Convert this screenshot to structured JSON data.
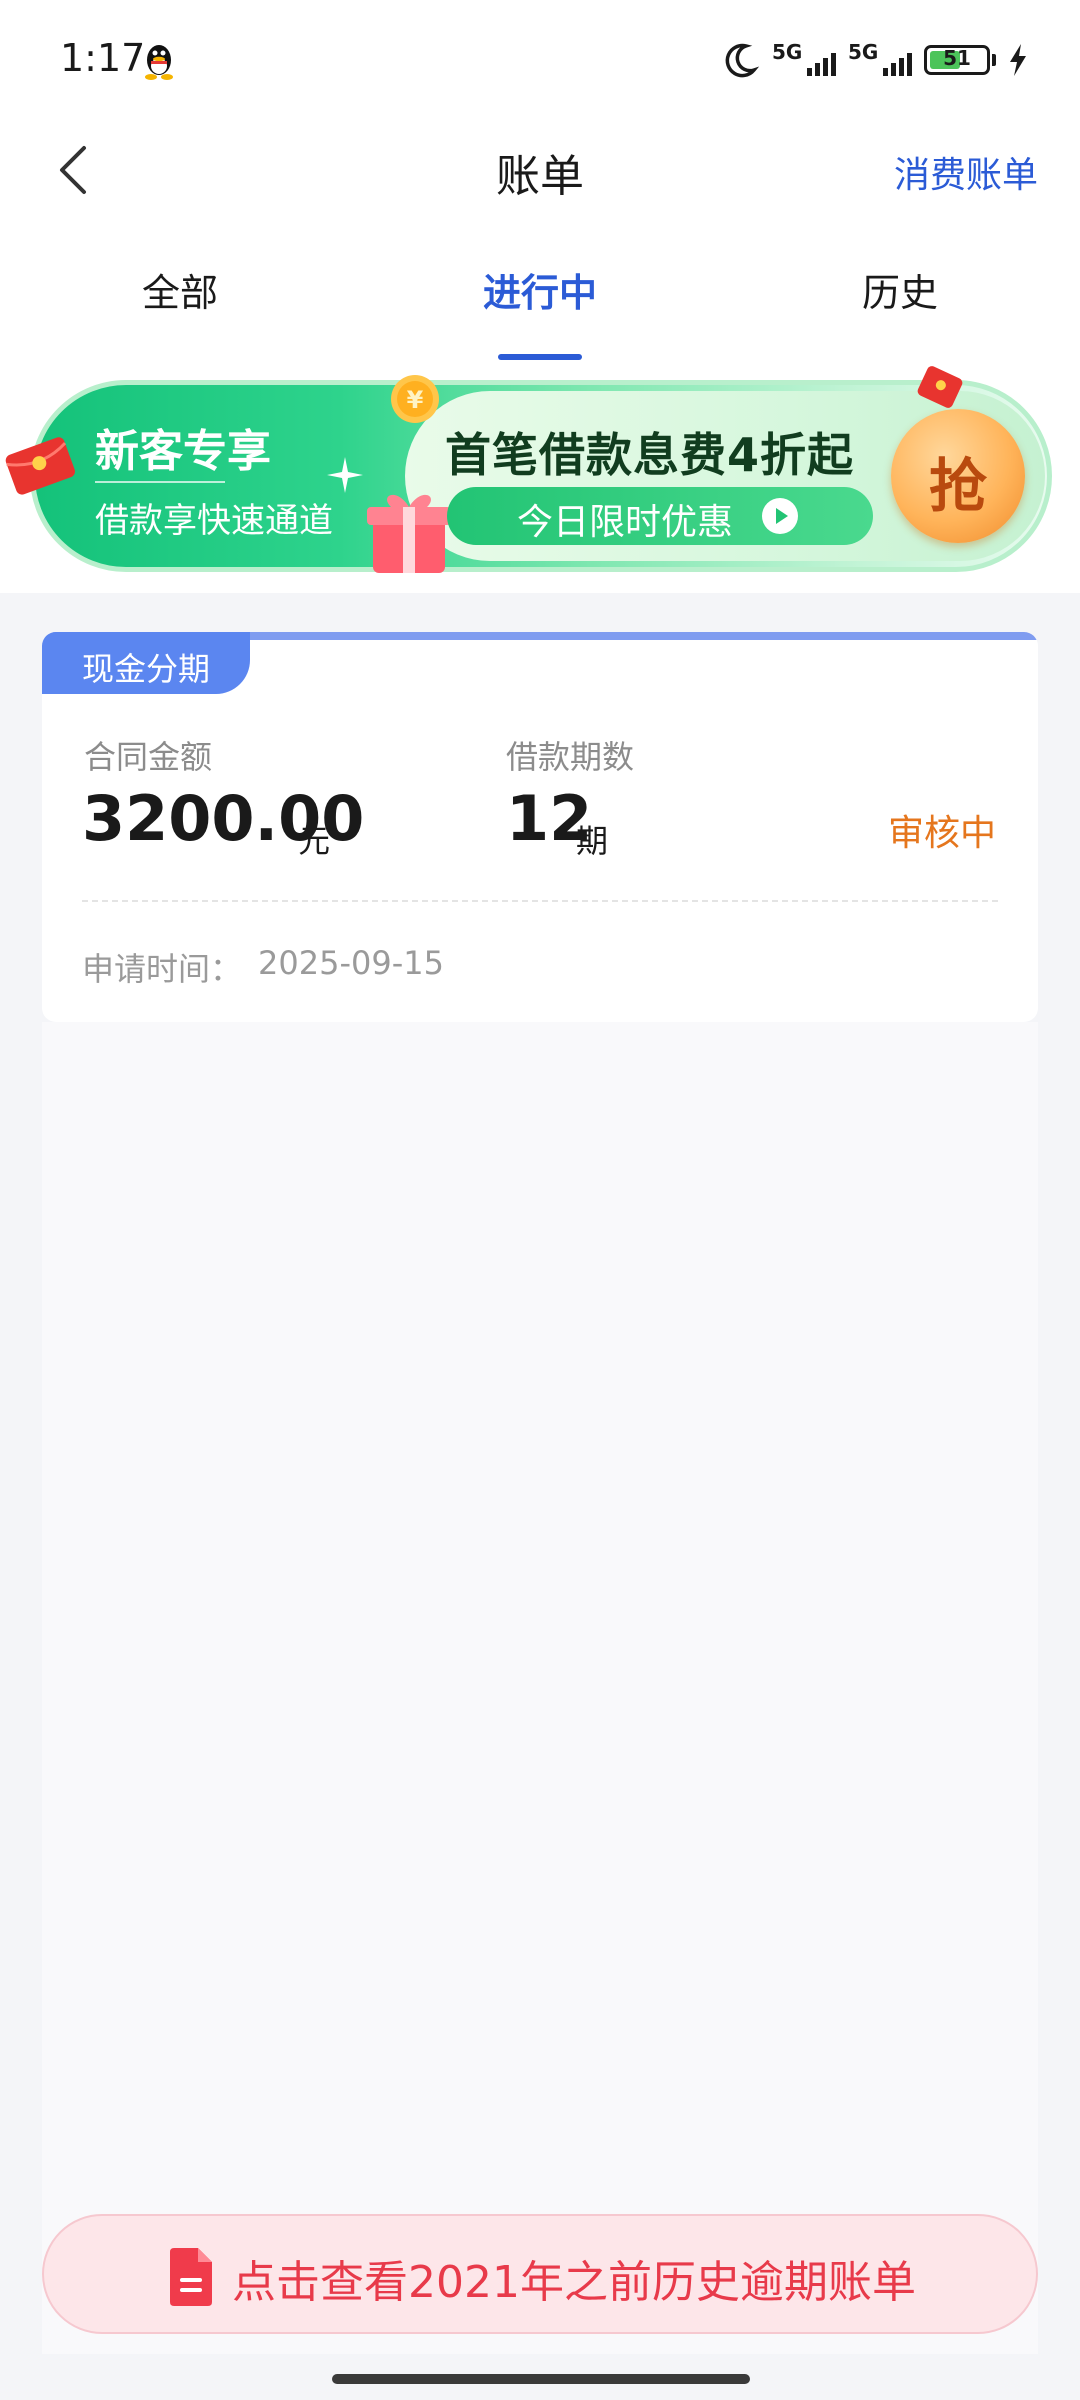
{
  "status_bar": {
    "time": "1:17",
    "network_1": "5G",
    "network_2": "5G",
    "battery_level": "51",
    "icons": [
      "qq-icon",
      "moon-icon",
      "signal-icon",
      "battery-icon",
      "charging-bolt-icon"
    ]
  },
  "nav": {
    "title": "账单",
    "right_link": "消费账单",
    "back_icon": "chevron-left-icon"
  },
  "tabs": [
    {
      "label": "全部",
      "active": false
    },
    {
      "label": "进行中",
      "active": true
    },
    {
      "label": "历史",
      "active": false
    }
  ],
  "banner": {
    "left_title": "新客专享",
    "left_sub": "借款享快速通道",
    "headline": "首笔借款息费4折起",
    "pill_text": "今日限时优惠",
    "grab_label": "抢",
    "colors": {
      "green": "#14c27a",
      "orange": "#f08a2a"
    }
  },
  "card": {
    "tag": "现金分期",
    "amount_label": "合同金额",
    "amount_value": "3200.00",
    "amount_unit": "元",
    "periods_label": "借款期数",
    "periods_value": "12",
    "periods_unit": "期",
    "status": "审核中",
    "date_label": "申请时间：",
    "date_value": "2025-09-15",
    "colors": {
      "tag": "#5b86f0",
      "status": "#e5761d"
    }
  },
  "history_bar": {
    "text": "点击查看2021年之前历史逾期账单",
    "icon": "document-icon",
    "color": "#e83a4a"
  }
}
